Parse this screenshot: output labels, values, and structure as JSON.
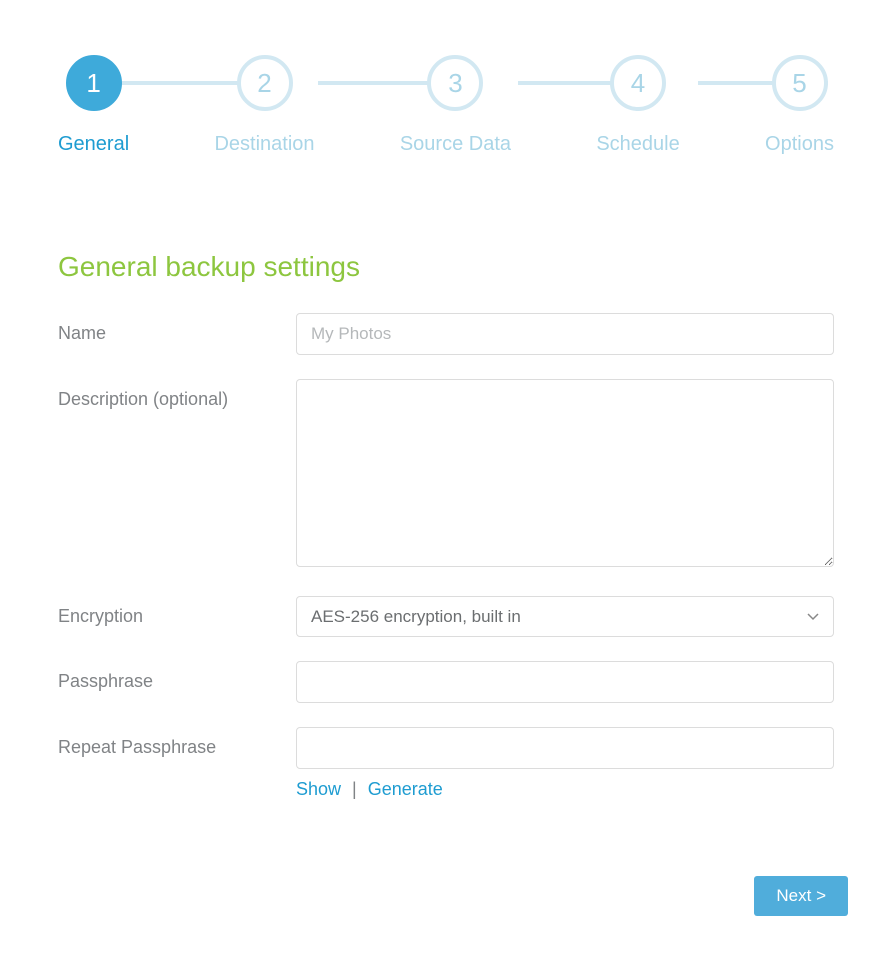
{
  "stepper": {
    "steps": [
      {
        "num": "1",
        "label": "General",
        "active": true
      },
      {
        "num": "2",
        "label": "Destination",
        "active": false
      },
      {
        "num": "3",
        "label": "Source Data",
        "active": false
      },
      {
        "num": "4",
        "label": "Schedule",
        "active": false
      },
      {
        "num": "5",
        "label": "Options",
        "active": false
      }
    ]
  },
  "heading": "General backup settings",
  "form": {
    "name": {
      "label": "Name",
      "placeholder": "My Photos",
      "value": ""
    },
    "description": {
      "label": "Description (optional)",
      "value": ""
    },
    "encryption": {
      "label": "Encryption",
      "selected": "AES-256 encryption, built in"
    },
    "passphrase": {
      "label": "Passphrase",
      "value": ""
    },
    "repeat_passphrase": {
      "label": "Repeat Passphrase",
      "value": ""
    },
    "show_link": "Show",
    "generate_link": "Generate",
    "separator": "|"
  },
  "next_button": "Next >"
}
